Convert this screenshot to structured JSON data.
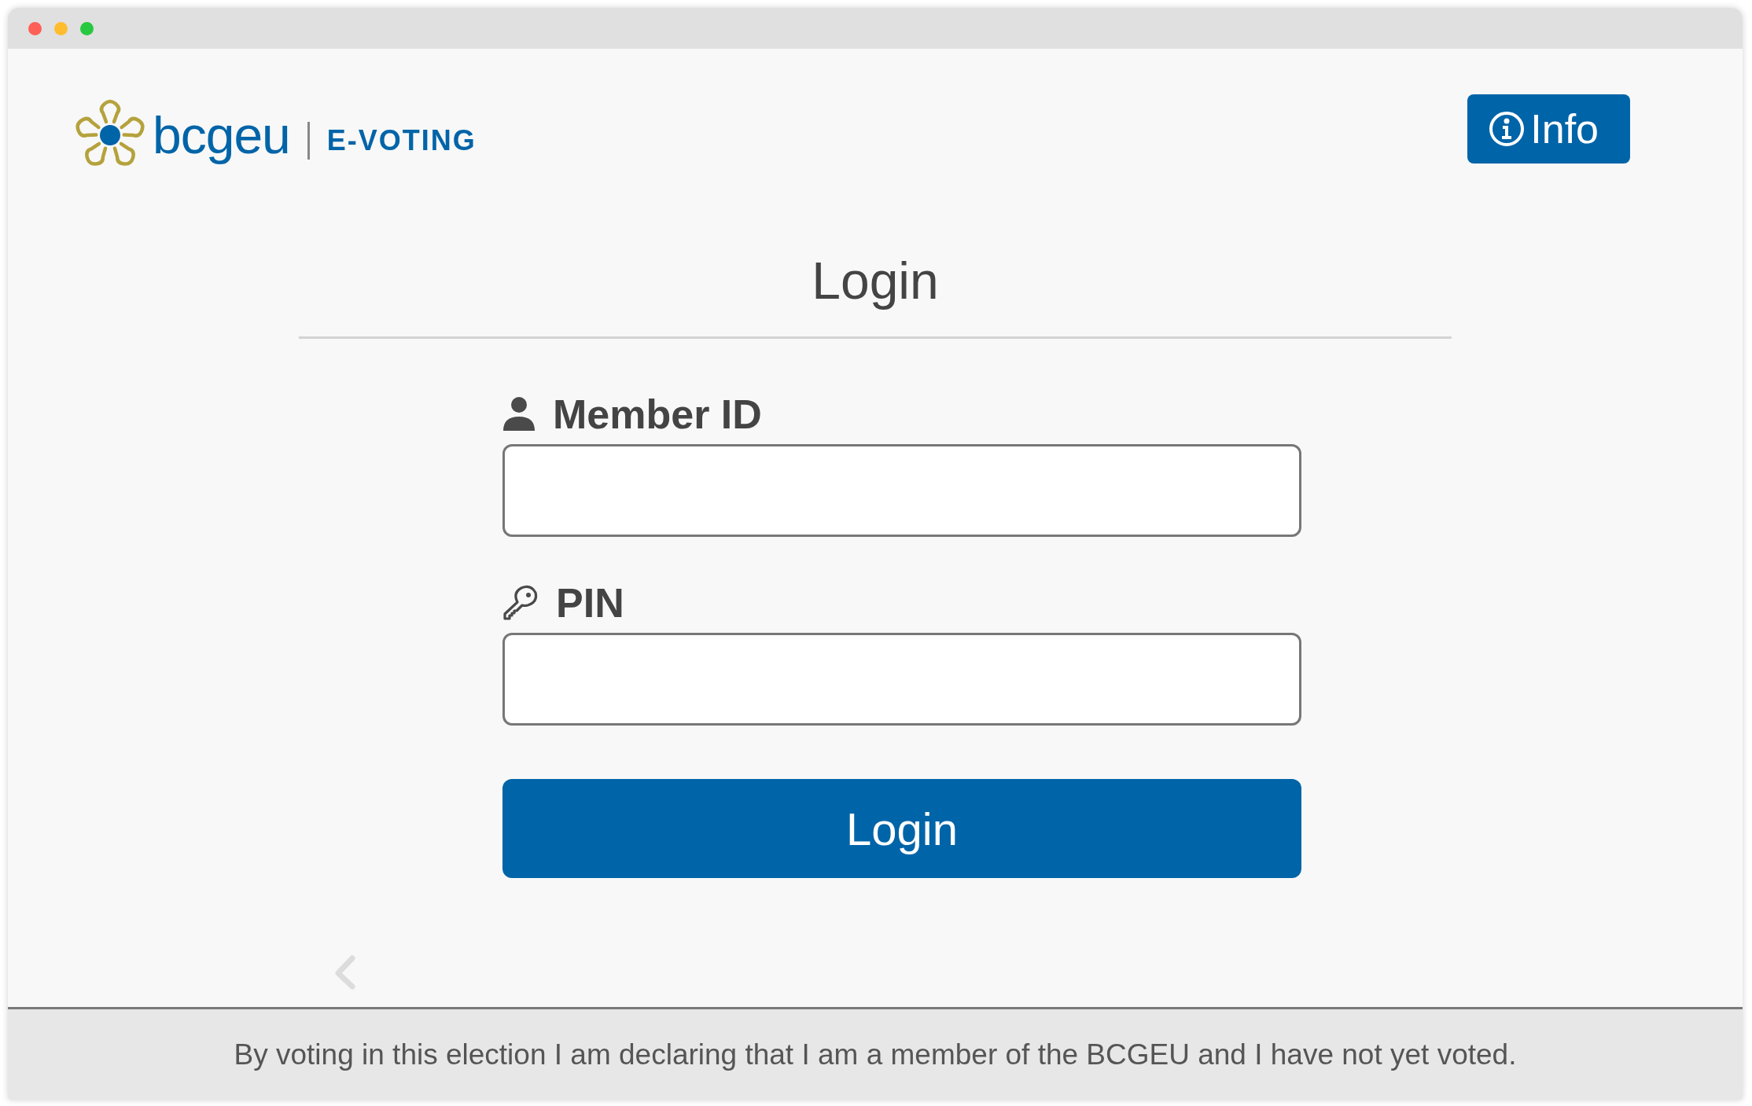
{
  "brand": {
    "name": "bcgeu",
    "product": "E-VOTING"
  },
  "info_button": {
    "label": "Info"
  },
  "heading": "Login",
  "fields": [
    {
      "label": "Member ID",
      "kind": "user"
    },
    {
      "label": "PIN",
      "kind": "key"
    }
  ],
  "login_button": {
    "label": "Login"
  },
  "footer": "By voting in this election I am declaring that I am a member of the BCGEU and I have not yet voted."
}
